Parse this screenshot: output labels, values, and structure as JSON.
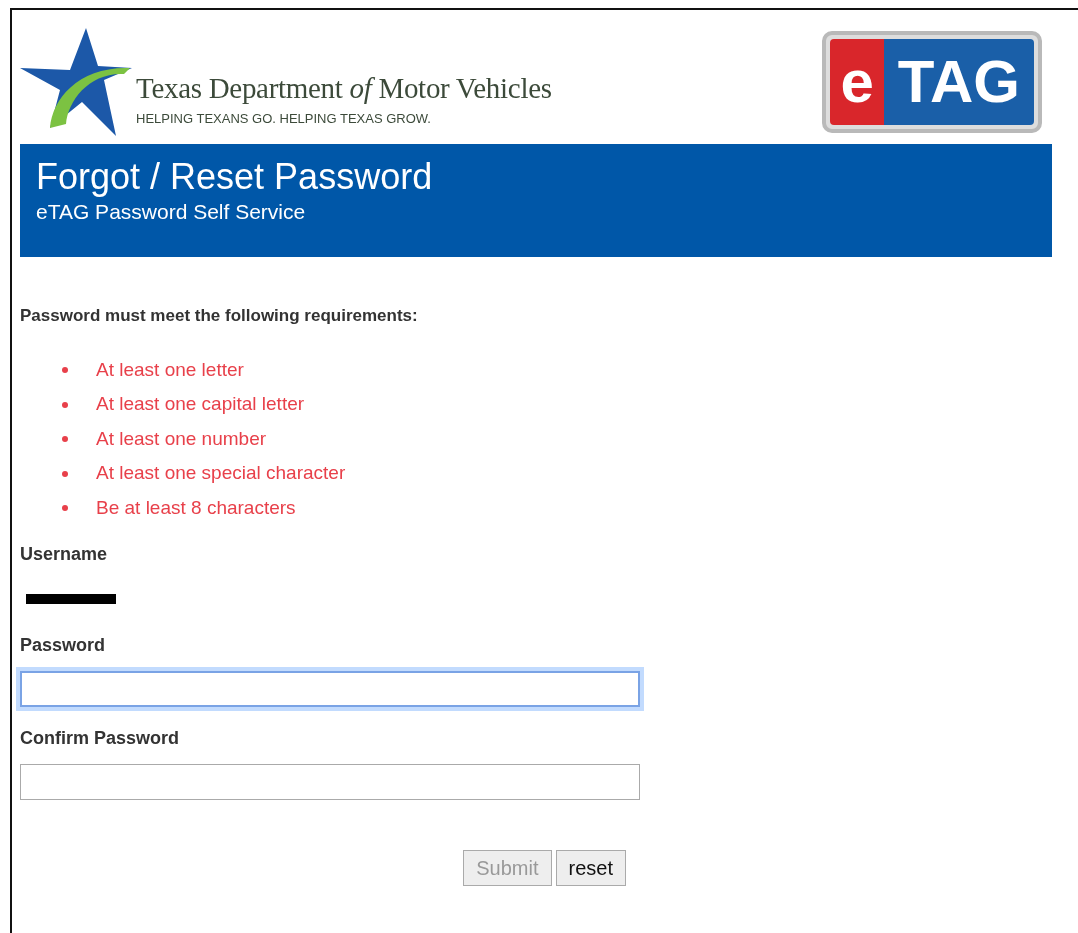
{
  "header": {
    "agency_name": "Texas Department *of* Motor Vehicles",
    "tagline": "HELPING TEXANS GO. HELPING TEXAS GROW.",
    "etag_logo": {
      "left": "e",
      "right": "TAG"
    }
  },
  "banner": {
    "title": "Forgot / Reset Password",
    "subtitle": "eTAG Password Self Service"
  },
  "requirements": {
    "heading": "Password must meet the following requirements:",
    "items": [
      {
        "text": "At least one letter"
      },
      {
        "text": "At least one capital letter"
      },
      {
        "text": "At least one number"
      },
      {
        "text": "At least one special character"
      },
      {
        "text": "Be at least 8 characters"
      }
    ]
  },
  "form": {
    "username": {
      "label": "Username",
      "redacted": true
    },
    "fields": [
      {
        "label": "Password",
        "focused": true
      },
      {
        "label": "Confirm Password",
        "focused": false
      }
    ],
    "buttons": [
      {
        "label": "Submit",
        "disabled": true
      },
      {
        "label": "reset",
        "disabled": false
      }
    ]
  }
}
